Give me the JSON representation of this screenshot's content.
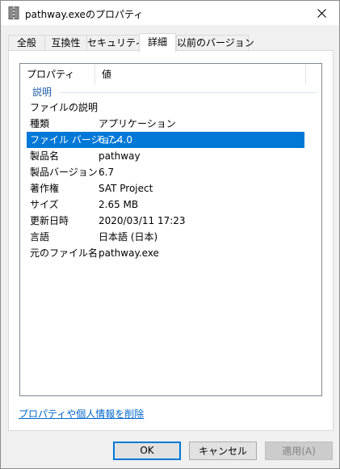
{
  "window": {
    "title": "pathway.exeのプロパティ"
  },
  "tabs": [
    {
      "label": "全般"
    },
    {
      "label": "互換性"
    },
    {
      "label": "セキュリティ"
    },
    {
      "label": "詳細"
    },
    {
      "label": "以前のバージョン"
    }
  ],
  "details": {
    "columns": {
      "property": "プロパティ",
      "value": "値"
    },
    "group": "説明",
    "rows": [
      {
        "property": "ファイルの説明",
        "value": ""
      },
      {
        "property": "種類",
        "value": "アプリケーション"
      },
      {
        "property": "ファイル バージョン",
        "value": "6.7.4.0"
      },
      {
        "property": "製品名",
        "value": "pathway"
      },
      {
        "property": "製品バージョン",
        "value": "6.7"
      },
      {
        "property": "著作権",
        "value": "SAT Project"
      },
      {
        "property": "サイズ",
        "value": "2.65 MB"
      },
      {
        "property": "更新日時",
        "value": "2020/03/11 17:23"
      },
      {
        "property": "言語",
        "value": "日本語 (日本)"
      },
      {
        "property": "元のファイル名",
        "value": "pathway.exe"
      }
    ]
  },
  "remove_link": "プロパティや個人情報を削除",
  "buttons": {
    "ok": "OK",
    "cancel": "キャンセル",
    "apply": "適用(A)"
  },
  "colors": {
    "selection": "#0078d7",
    "link": "#0066cc",
    "group": "#1e5aa8"
  }
}
